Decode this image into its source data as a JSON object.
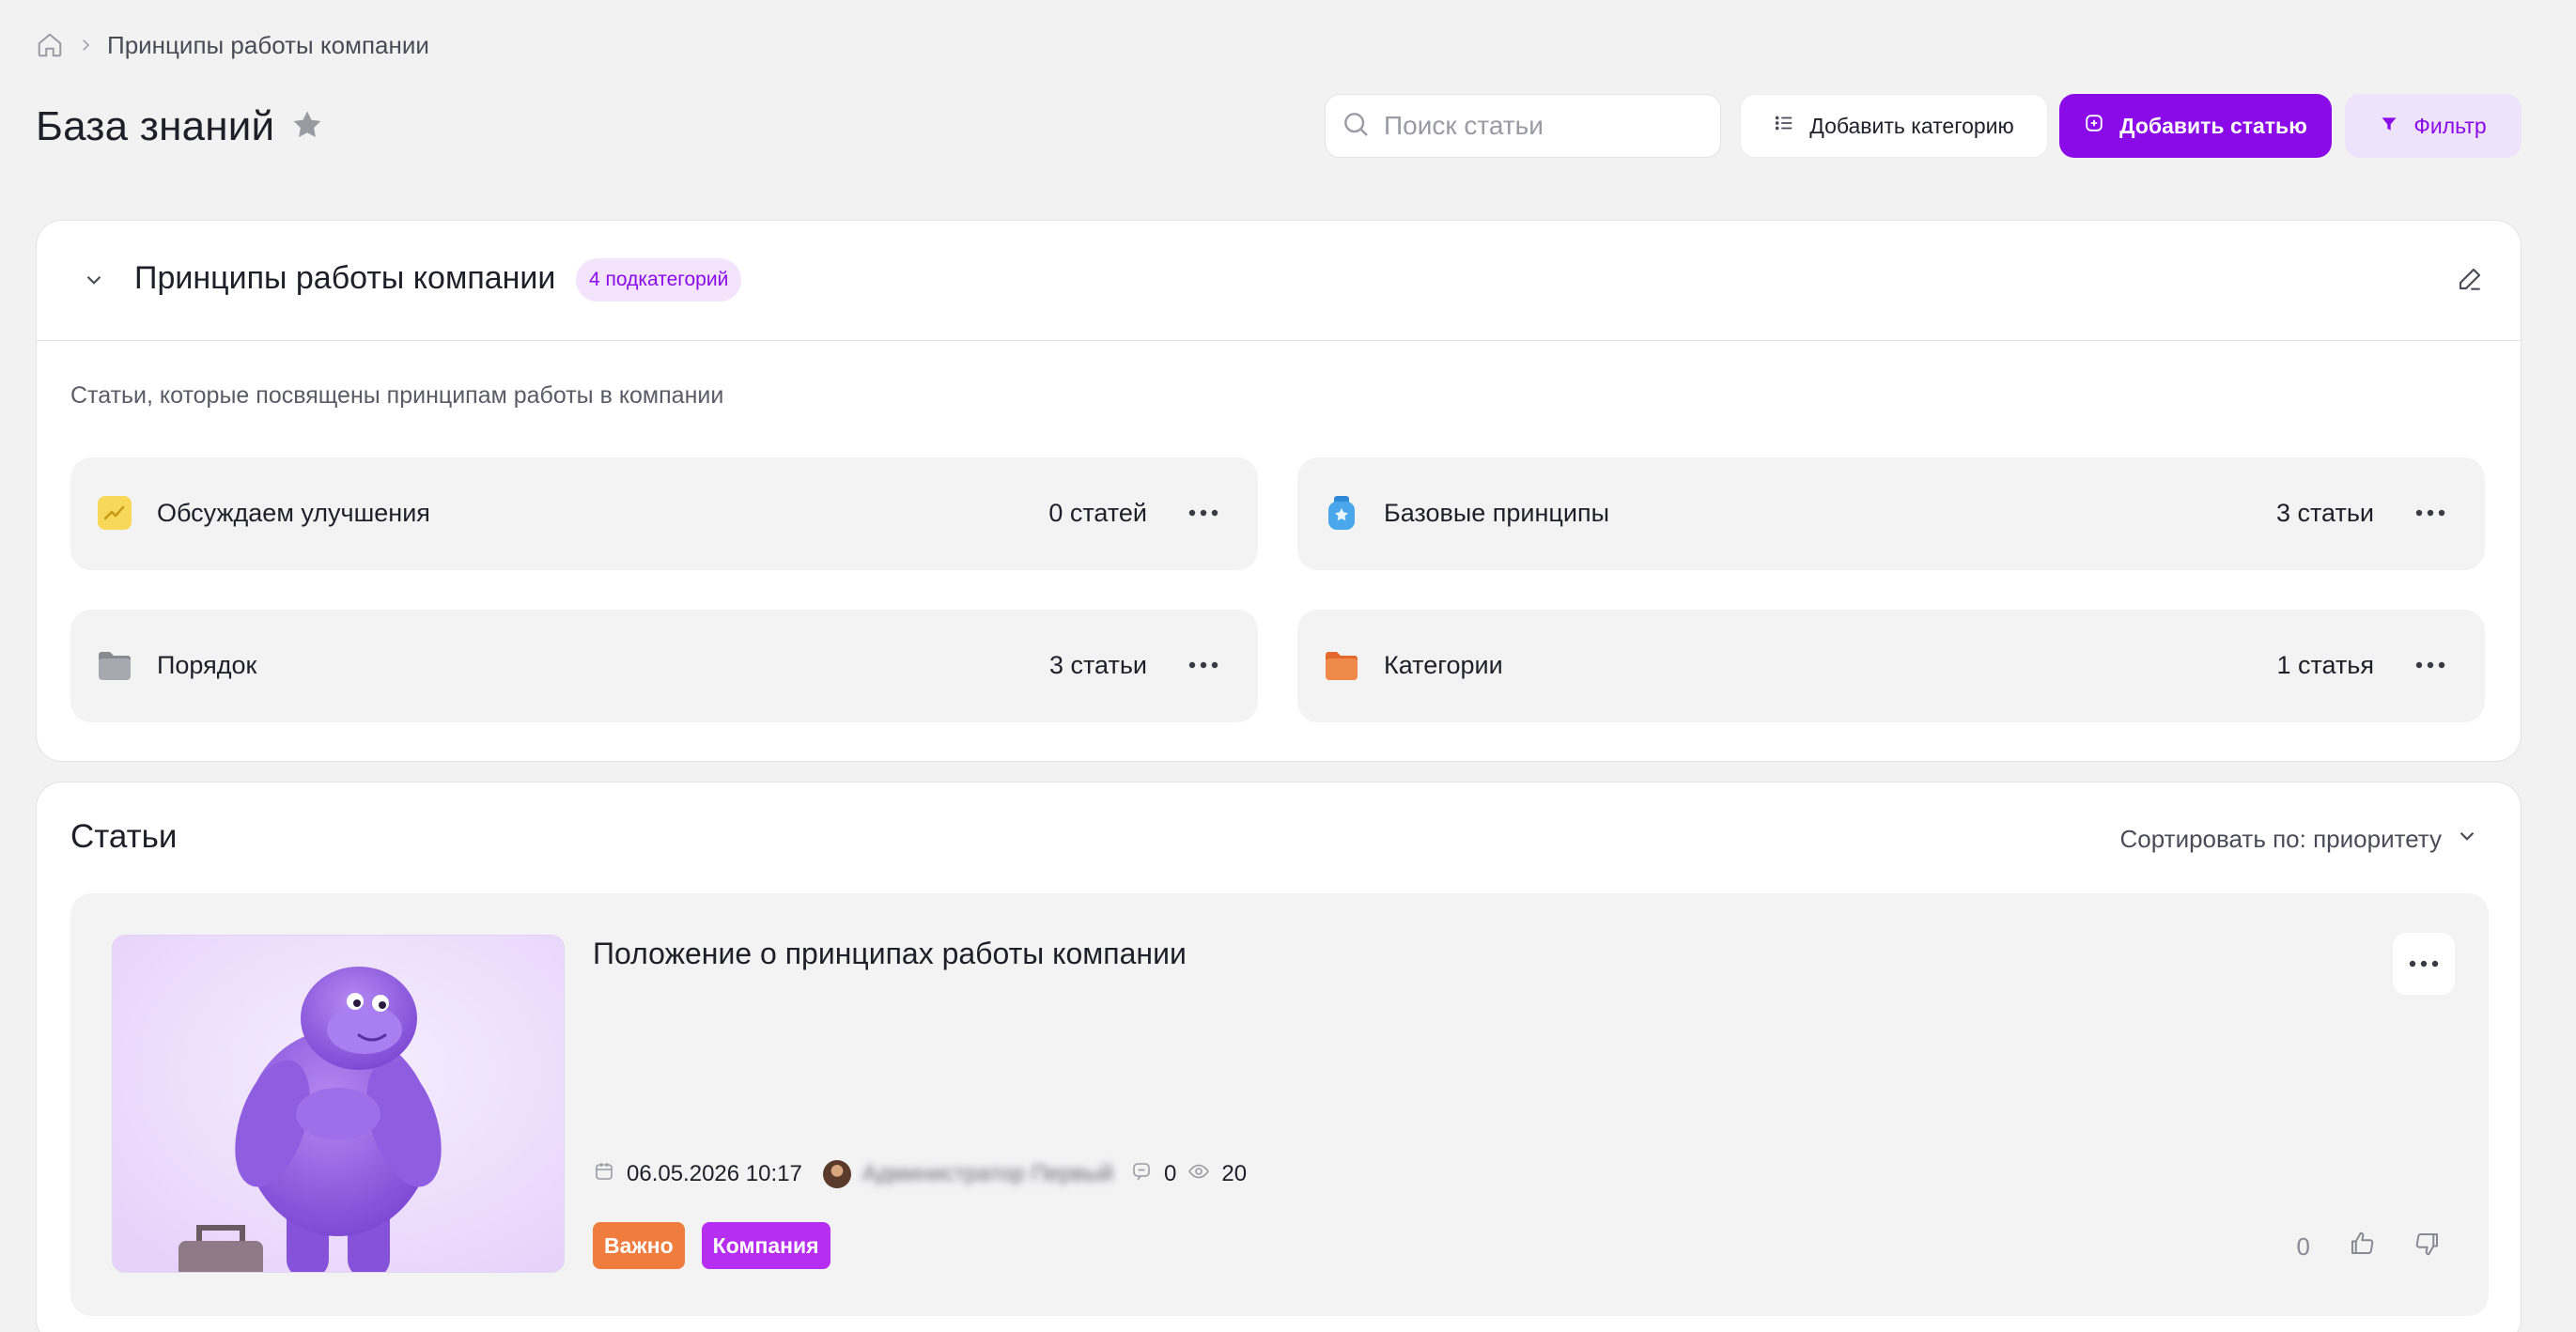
{
  "breadcrumb": {
    "current": "Принципы работы компании"
  },
  "header": {
    "title": "База знаний",
    "search_placeholder": "Поиск статьи",
    "add_category_label": "Добавить категорию",
    "add_article_label": "Добавить статью",
    "filter_label": "Фильтр"
  },
  "category": {
    "title": "Принципы работы компании",
    "badge": "4 подкатегорий",
    "description": "Статьи, которые посвящены принципам работы в компании",
    "subcategories": [
      {
        "name": "Обсуждаем улучшения",
        "count": "0 статей",
        "icon": "trend-chart-icon",
        "color": "#f7d859"
      },
      {
        "name": "Базовые принципы",
        "count": "3 статьи",
        "icon": "badge-icon",
        "color": "#4aa7ec"
      },
      {
        "name": "Порядок",
        "count": "3 статьи",
        "icon": "folder-icon",
        "color": "#9e9ea6"
      },
      {
        "name": "Категории",
        "count": "1 статья",
        "icon": "folder-icon",
        "color": "#f08a4b"
      }
    ]
  },
  "articles": {
    "title": "Статьи",
    "sort_label": "Сортировать по: приоритету",
    "items": [
      {
        "title": "Положение о принципах работы компании",
        "date": "06.05.2026 10:17",
        "author": "Администратор Первый",
        "comments": "0",
        "views": "20",
        "tags": [
          "Важно",
          "Компания"
        ],
        "rating": "0"
      }
    ]
  },
  "colors": {
    "accent": "#8a0ae8",
    "accent_soft": "#efe2fb",
    "tag_important": "#f07c3e",
    "tag_company": "#b62ef0"
  }
}
